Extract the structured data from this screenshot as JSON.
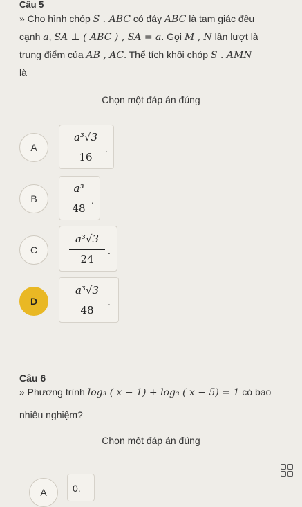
{
  "q5": {
    "title": "Câu 5",
    "line1_a": "» Cho hình chóp ",
    "line1_math1": "S . ABC",
    "line1_b": " có đáy ",
    "line1_math2": "ABC",
    "line1_c": " là tam giác đều",
    "line2_a": "cạnh ",
    "line2_math1": "a",
    "line2_b": ", ",
    "line2_math2": "SA ⊥ ( ABC ) , SA = a",
    "line2_c": ". Gọi ",
    "line2_math3": "M , N",
    "line2_d": " lần lượt là",
    "line3_a": "trung điểm của ",
    "line3_math1": "AB , AC",
    "line3_b": ". Thể tích khối chóp ",
    "line3_math2": "S . AMN",
    "line4": "là",
    "prompt": "Chọn một đáp án đúng",
    "options": [
      {
        "letter": "A",
        "num": "a³√3",
        "den": "16"
      },
      {
        "letter": "B",
        "num": "a³",
        "den": "48"
      },
      {
        "letter": "C",
        "num": "a³√3",
        "den": "24"
      },
      {
        "letter": "D",
        "num": "a³√3",
        "den": "48"
      }
    ],
    "selected": "D"
  },
  "q6": {
    "title": "Câu 6",
    "line1_a": "» Phương trình ",
    "line1_math": "log₃ ( x − 1) + log₃ ( x − 5) = 1",
    "line1_b": " có bao",
    "line2": "nhiêu nghiệm?",
    "prompt": "Chọn một đáp án đúng",
    "option_a_letter": "A",
    "option_a_value": "0."
  },
  "icons": {
    "grid": "grid-view-icon"
  },
  "colors": {
    "selected": "#e9b824",
    "background": "#efede8"
  }
}
